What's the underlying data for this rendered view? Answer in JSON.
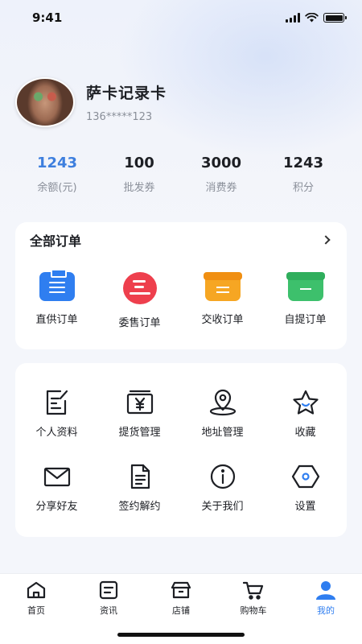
{
  "status_bar": {
    "time": "9:41"
  },
  "profile": {
    "name": "萨卡记录卡",
    "phone": "136*****123"
  },
  "stats": [
    {
      "value": "1243",
      "label": "余额(元)"
    },
    {
      "value": "100",
      "label": "批发券"
    },
    {
      "value": "3000",
      "label": "消费券"
    },
    {
      "value": "1243",
      "label": "积分"
    }
  ],
  "orders": {
    "title": "全部订单",
    "items": [
      {
        "label": "直供订单",
        "icon": "clipboard-list-icon"
      },
      {
        "label": "委售订单",
        "icon": "hand-consign-icon"
      },
      {
        "label": "交收订单",
        "icon": "box-exchange-icon"
      },
      {
        "label": "自提订单",
        "icon": "box-pickup-icon"
      }
    ]
  },
  "tools": [
    {
      "label": "个人资料",
      "icon": "edit-profile-icon"
    },
    {
      "label": "提货管理",
      "icon": "yen-box-icon"
    },
    {
      "label": "地址管理",
      "icon": "location-pin-icon"
    },
    {
      "label": "收藏",
      "icon": "star-icon"
    },
    {
      "label": "分享好友",
      "icon": "envelope-icon"
    },
    {
      "label": "签约解约",
      "icon": "document-icon"
    },
    {
      "label": "关于我们",
      "icon": "info-icon"
    },
    {
      "label": "设置",
      "icon": "settings-hexagon-icon"
    }
  ],
  "tabbar": [
    {
      "label": "首页",
      "icon": "home-icon",
      "active": false
    },
    {
      "label": "资讯",
      "icon": "news-icon",
      "active": false
    },
    {
      "label": "店铺",
      "icon": "store-icon",
      "active": false
    },
    {
      "label": "购物车",
      "icon": "cart-icon",
      "active": false
    },
    {
      "label": "我的",
      "icon": "user-icon",
      "active": true
    }
  ],
  "colors": {
    "accent": "#2f7ef0",
    "stat_accent": "#3e7fde",
    "muted": "#8a8f99",
    "background": "#f4f6fb"
  }
}
